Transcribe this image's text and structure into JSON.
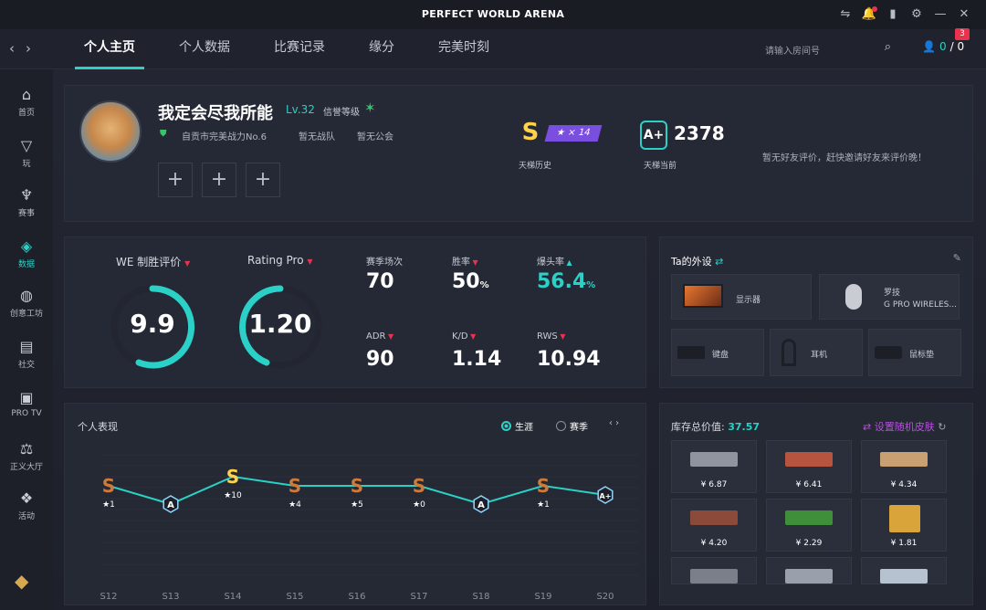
{
  "window": {
    "title": "PERFECT WORLD ARENA"
  },
  "nav": {
    "tabs": [
      "个人主页",
      "个人数据",
      "比赛记录",
      "缘分",
      "完美时刻"
    ],
    "search_placeholder": "请输入房间号",
    "friends_online": "0",
    "friends_total": "/ 0",
    "badge": "3"
  },
  "sidebar": [
    {
      "label": "首页",
      "icon": "home-icon"
    },
    {
      "label": "玩",
      "icon": "play-icon"
    },
    {
      "label": "赛事",
      "icon": "trophy-icon"
    },
    {
      "label": "数据",
      "icon": "data-icon"
    },
    {
      "label": "创意工坊",
      "icon": "workshop-icon"
    },
    {
      "label": "社交",
      "icon": "social-icon"
    },
    {
      "label": "PRO TV",
      "icon": "tv-icon"
    },
    {
      "label": "正义大厅",
      "icon": "scale-icon"
    },
    {
      "label": "活动",
      "icon": "event-icon"
    }
  ],
  "profile": {
    "name": "我定会尽我所能",
    "level": "Lv.32",
    "credit_label": "信誉等级",
    "team_label": "自贡市完美战力No.6",
    "no_team": "暂无战队",
    "no_guild": "暂无公会",
    "ladder_history_label": "天梯历史",
    "ladder_star": "★ × 14",
    "ladder_current_label": "天梯当前",
    "elo": "2378",
    "friend_eval": "暂无好友评价，赶快邀请好友来评价晚！"
  },
  "stats": {
    "we_label": "WE 制胜评价",
    "we_value": "9.9",
    "rating_label": "Rating Pro",
    "rating_value": "1.20",
    "items": [
      {
        "label": "赛季场次",
        "value": "70"
      },
      {
        "label": "胜率",
        "value": "50",
        "unit": "%"
      },
      {
        "label": "爆头率",
        "value": "56.4",
        "unit": "%"
      },
      {
        "label": "ADR",
        "value": "90"
      },
      {
        "label": "K/D",
        "value": "1.14"
      },
      {
        "label": "RWS",
        "value": "10.94"
      }
    ],
    "colors": {
      "accent": "#2bd0c6",
      "arc_track": "#232631"
    }
  },
  "gear": {
    "title": "Ta的外设",
    "monitor": "显示器",
    "mouse_brand": "罗技",
    "mouse_model": "G PRO WIRELES...",
    "keyboard": "键盘",
    "headset": "耳机",
    "mousepad": "鼠标垫"
  },
  "performance": {
    "title": "个人表现",
    "career": "生涯",
    "season": "赛季"
  },
  "chart_data": {
    "type": "line",
    "categories": [
      "S12",
      "S13",
      "S14",
      "S15",
      "S16",
      "S17",
      "S18",
      "S19",
      "S20"
    ],
    "ranks": [
      "S",
      "A",
      "S",
      "S",
      "S",
      "S",
      "A",
      "S",
      "A+"
    ],
    "stars": [
      "★1",
      "",
      "★10",
      "★4",
      "★5",
      "★0",
      "",
      "★1",
      ""
    ],
    "values": [
      3,
      1,
      4,
      3,
      3,
      3,
      1,
      3,
      2
    ]
  },
  "inventory": {
    "title": "库存总价值:",
    "value": "37.57",
    "random": "设置随机皮肤",
    "prices": [
      "¥ 6.87",
      "¥ 6.41",
      "¥ 4.34",
      "¥ 4.20",
      "¥ 2.29",
      "¥ 1.81",
      "",
      "",
      ""
    ]
  }
}
